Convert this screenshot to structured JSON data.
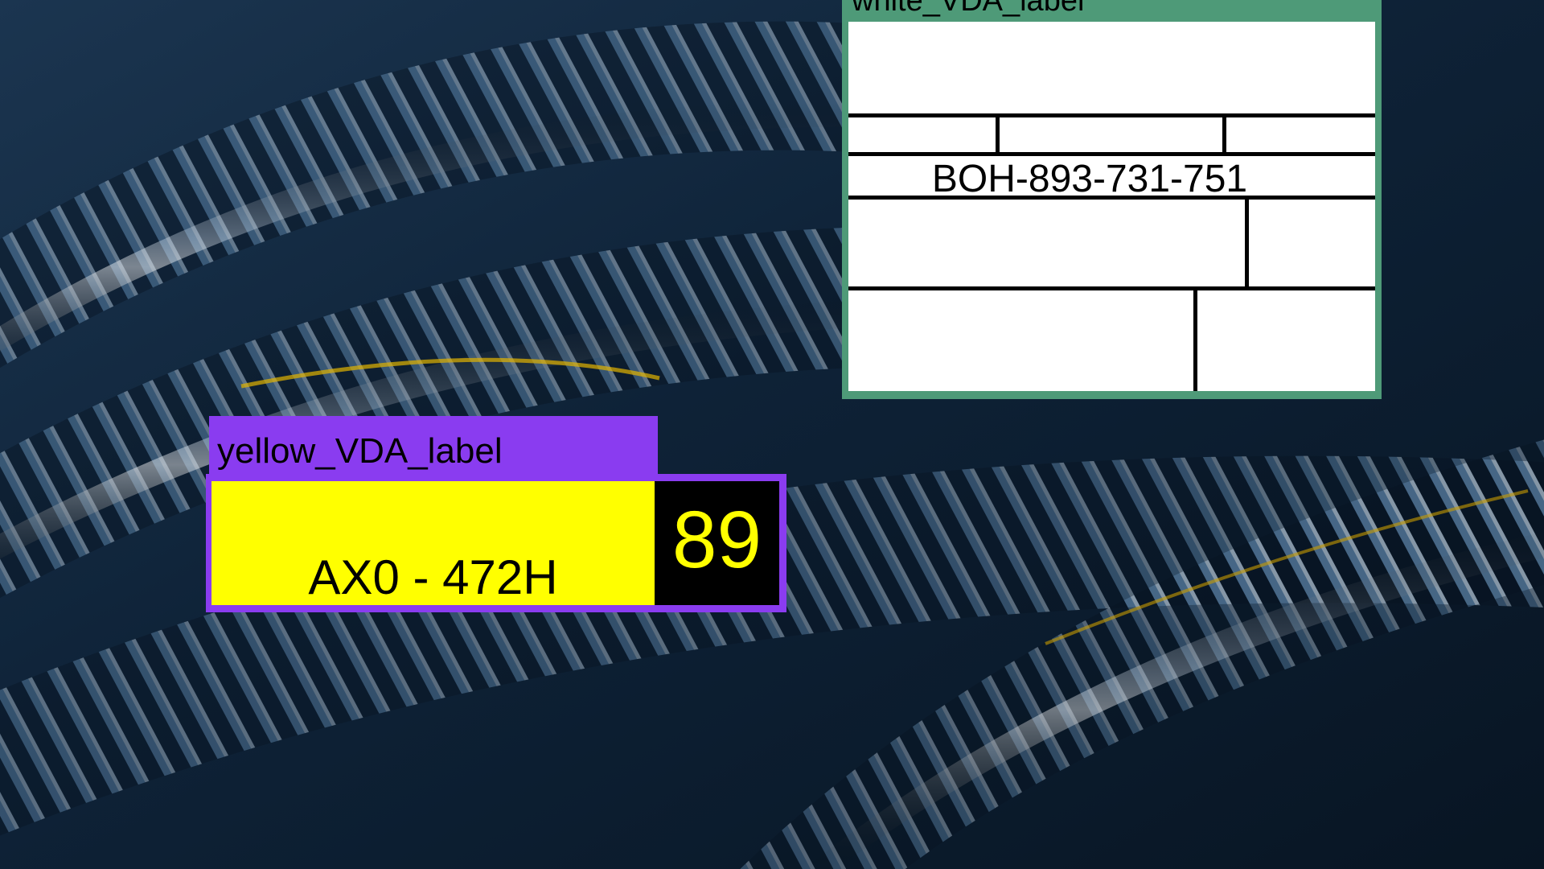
{
  "white_label": {
    "caption": "white_VDA_label",
    "code": "BOH-893-731-751",
    "frame_color": "#4e9a78"
  },
  "yellow_label": {
    "caption": "yellow_VDA_label",
    "code": "AX0 - 472H",
    "number": "89",
    "frame_color": "#8a3cf0",
    "label_color": "#ffff00"
  }
}
